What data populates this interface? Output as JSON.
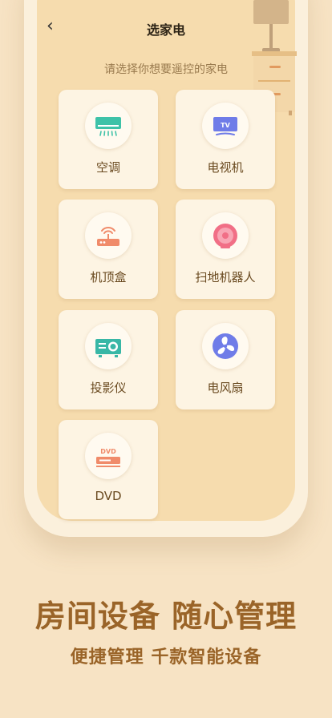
{
  "header": {
    "title": "选家电",
    "back_icon": "chevron-left-icon"
  },
  "subtitle": "请选择你想要遥控的家电",
  "devices": [
    {
      "label": "空调",
      "icon": "air-conditioner-icon",
      "color": "#3ec2a8"
    },
    {
      "label": "电视机",
      "icon": "tv-icon",
      "color": "#6f7ce8"
    },
    {
      "label": "机顶盒",
      "icon": "set-top-box-icon",
      "color": "#f08b6a"
    },
    {
      "label": "扫地机器人",
      "icon": "robot-vacuum-icon",
      "color": "#f16f86"
    },
    {
      "label": "投影仪",
      "icon": "projector-icon",
      "color": "#38b7a6"
    },
    {
      "label": "电风扇",
      "icon": "fan-icon",
      "color": "#6f7ce8"
    },
    {
      "label": "DVD",
      "icon": "dvd-player-icon",
      "color": "#f08b6a",
      "badge": "DVD"
    }
  ],
  "tv_badge": "TV",
  "promo": {
    "headline": "房间设备 随心管理",
    "subline": "便捷管理 千款智能设备"
  },
  "colors": {
    "background": "#f7e3c4",
    "screen": "#f6dcae",
    "accent": "#9a6428"
  }
}
